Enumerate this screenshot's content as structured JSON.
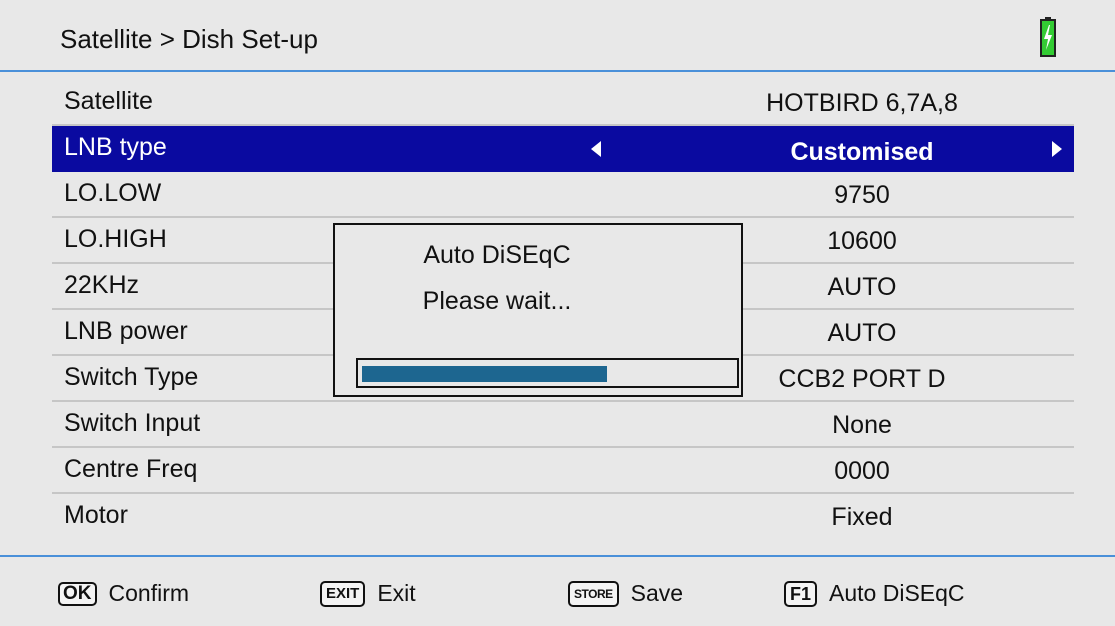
{
  "header": {
    "title": "Satellite > Dish Set-up",
    "battery_icon": "battery-charging-icon",
    "battery_color": "#33cc33"
  },
  "settings": [
    {
      "label": "Satellite",
      "value": "HOTBIRD 6,7A,8"
    },
    {
      "label": "LNB type",
      "value": "Customised",
      "selected": true
    },
    {
      "label": "LO.LOW",
      "value": "9750"
    },
    {
      "label": "LO.HIGH",
      "value": "10600"
    },
    {
      "label": "22KHz",
      "value": "AUTO"
    },
    {
      "label": "LNB power",
      "value": "AUTO"
    },
    {
      "label": "Switch Type",
      "value": "CCB2 PORT D"
    },
    {
      "label": "Switch Input",
      "value": "None"
    },
    {
      "label": "Centre Freq",
      "value": "0000"
    },
    {
      "label": "Motor",
      "value": "Fixed"
    }
  ],
  "dialog": {
    "title": "Auto DiSEqC",
    "message": "Please wait...",
    "progress": 0.66
  },
  "footer": {
    "ok_key": "OK",
    "ok_label": "Confirm",
    "exit_key": "EXIT",
    "exit_label": "Exit",
    "store_key": "STORE",
    "store_label": "Save",
    "f1_key": "F1",
    "f1_label": "Auto DiSEqC"
  },
  "colors": {
    "accent_line": "#4a90d9",
    "selected_row": "#0a0aa0",
    "progress_fill": "#1d6690"
  }
}
